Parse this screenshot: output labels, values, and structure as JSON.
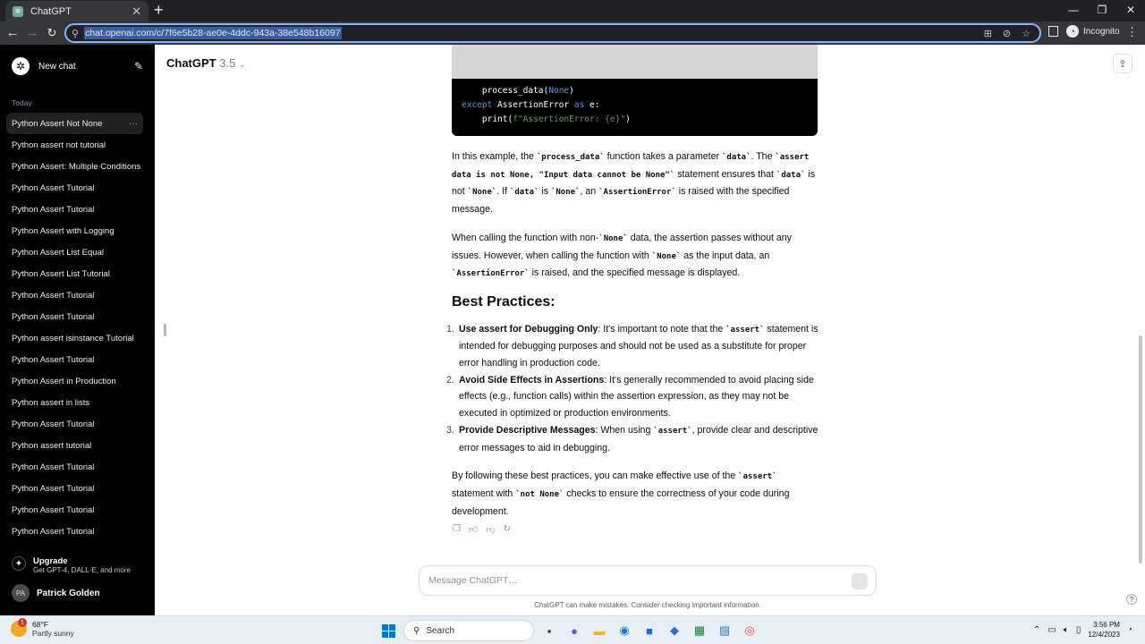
{
  "browser": {
    "tab_title": "ChatGPT",
    "url": "chat.openai.com/c/7f6e5b28-ae0e-4ddc-943a-38e548b16097",
    "profile_label": "Incognito"
  },
  "sidebar": {
    "new_chat_label": "New chat",
    "section_today": "Today",
    "items": [
      {
        "label": "Python Assert Not None"
      },
      {
        "label": "Python assert not tutorial"
      },
      {
        "label": "Python Assert: Multiple Conditions"
      },
      {
        "label": "Python Assert Tutorial"
      },
      {
        "label": "Python Assert Tutorial"
      },
      {
        "label": "Python Assert with Logging"
      },
      {
        "label": "Python Assert List Equal"
      },
      {
        "label": "Python Assert List Tutorial"
      },
      {
        "label": "Python Assert Tutorial"
      },
      {
        "label": "Python Assert Tutorial"
      },
      {
        "label": "Python assert isinstance Tutorial"
      },
      {
        "label": "Python Assert Tutorial"
      },
      {
        "label": "Python Assert in Production"
      },
      {
        "label": "Python assert in lists"
      },
      {
        "label": "Python Assert Tutorial"
      },
      {
        "label": "Python assert tutorial"
      },
      {
        "label": "Python Assert Tutorial"
      },
      {
        "label": "Python Assert Tutorial"
      },
      {
        "label": "Python Assert Tutorial"
      },
      {
        "label": "Python Assert Tutorial"
      }
    ],
    "upgrade_title": "Upgrade",
    "upgrade_subtitle": "Get GPT-4, DALL·E, and more",
    "user_initials": "PA",
    "user_name": "Patrick Golden"
  },
  "header": {
    "model_name": "ChatGPT",
    "model_version": "3.5"
  },
  "code": {
    "line1_fn": "process_data(",
    "line1_arg": "None",
    "line1_end": ")",
    "line2_kw": "except",
    "line2_mid": " AssertionError ",
    "line2_as": "as",
    "line2_end": " e:",
    "line3_fn": "print(",
    "line3_str": "f\"AssertionError: {e}\"",
    "line3_end": ")"
  },
  "response": {
    "p1_a": "In this example, the ",
    "p1_code1": "`process_data`",
    "p1_b": " function takes a parameter ",
    "p1_code2": "`data`",
    "p1_c": ". The ",
    "p1_code3": "`assert data is not None, \"Input data cannot be None\"`",
    "p1_d": " statement ensures that ",
    "p1_code4": "`data`",
    "p1_e": " is not ",
    "p1_code5": "`None`",
    "p1_f": ". If ",
    "p1_code6": "`data`",
    "p1_g": " is ",
    "p1_code7": "`None`",
    "p1_h": ", an ",
    "p1_code8": "`AssertionError`",
    "p1_i": " is raised with the specified message.",
    "p2_a": "When calling the function with non-",
    "p2_code1": "`None`",
    "p2_b": " data, the assertion passes without any issues. However, when calling the function with ",
    "p2_code2": "`None`",
    "p2_c": " as the input data, an ",
    "p2_code3": "`AssertionError`",
    "p2_d": " is raised, and the specified message is displayed.",
    "heading": "Best Practices:",
    "bp1_num": "1.",
    "bp1_title": "Use assert for Debugging Only",
    "bp1_a": ": It's important to note that the ",
    "bp1_code": "`assert`",
    "bp1_b": " statement is intended for debugging purposes and should not be used as a substitute for proper error handling in production code.",
    "bp2_num": "2.",
    "bp2_title": "Avoid Side Effects in Assertions",
    "bp2_a": ": It's generally recommended to avoid placing side effects (e.g., function calls) within the assertion expression, as they may not be executed in optimized or production environments.",
    "bp3_num": "3.",
    "bp3_title": "Provide Descriptive Messages",
    "bp3_a": ": When using ",
    "bp3_code": "`assert`",
    "bp3_b": ", provide clear and descriptive error messages to aid in debugging.",
    "p3_a": "By following these best practices, you can make effective use of the ",
    "p3_code1": "`assert`",
    "p3_b": " statement with ",
    "p3_code2": "`not None`",
    "p3_c": " checks to ensure the correctness of your code during development."
  },
  "composer": {
    "placeholder": "Message ChatGPT…",
    "disclaimer": "ChatGPT can make mistakes. Consider checking important information."
  },
  "taskbar": {
    "temperature": "68°F",
    "condition": "Partly sunny",
    "weather_badge": "1",
    "search_label": "Search",
    "time": "3:56 PM",
    "date": "12/4/2023"
  }
}
